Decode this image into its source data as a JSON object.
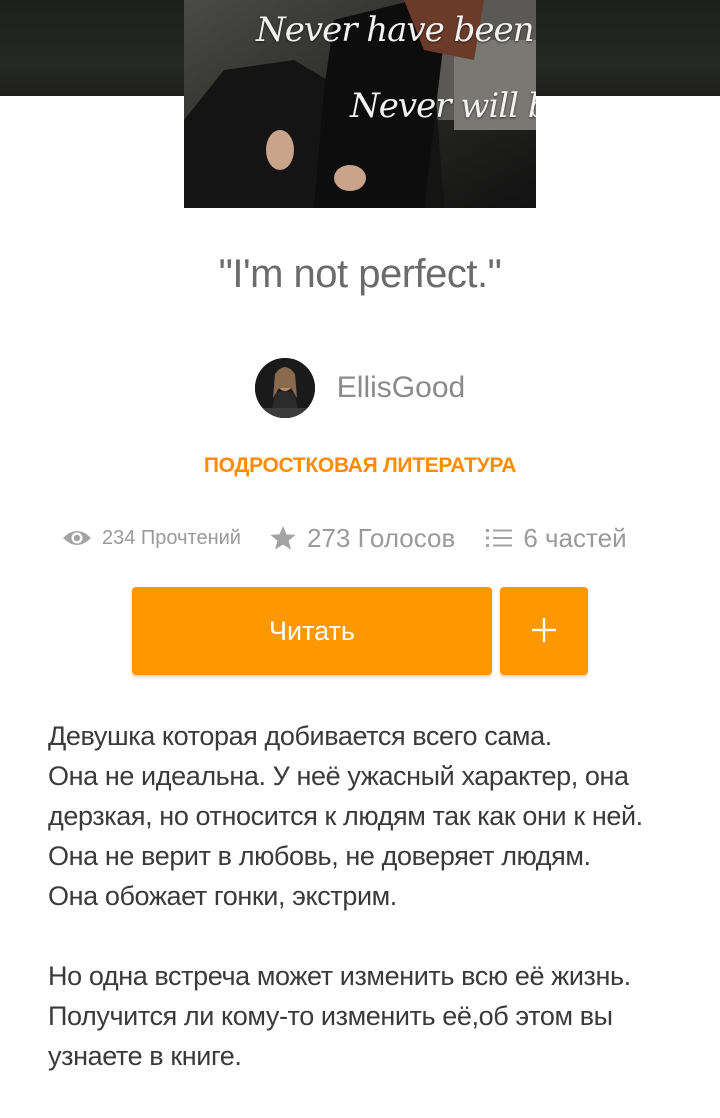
{
  "cover": {
    "line1": "Never have been",
    "line2": "Never will be"
  },
  "story": {
    "title": "\"I'm not perfect.\"",
    "author": "EllisGood",
    "genre": "ПОДРОСТКОВАЯ ЛИТЕРАТУРА"
  },
  "stats": {
    "reads": "234 Прочтений",
    "votes": "273 Голосов",
    "parts": "6 частей",
    "reads_icon": "eye-icon",
    "votes_icon": "star-icon",
    "parts_icon": "list-icon"
  },
  "actions": {
    "read_label": "Читать",
    "add_label": "+",
    "add_icon": "plus-icon"
  },
  "description": {
    "paragraph1": [
      "Девушка которая добивается всего сама.",
      "Она не идеальна. У неё ужасный характер, она дерзкая, но относится к людям так как они к ней.",
      "Она не верит в любовь, не доверяет людям.",
      "Она обожает гонки, экстрим."
    ],
    "paragraph2": "Но одна встреча может изменить всю её жизнь. Получится ли кому-то изменить её,об этом вы узнаете в книге."
  },
  "colors": {
    "accent": "#ff9800",
    "genre": "#ff8c00",
    "muted_text": "#9a9a9a",
    "top_band": "#232521"
  }
}
